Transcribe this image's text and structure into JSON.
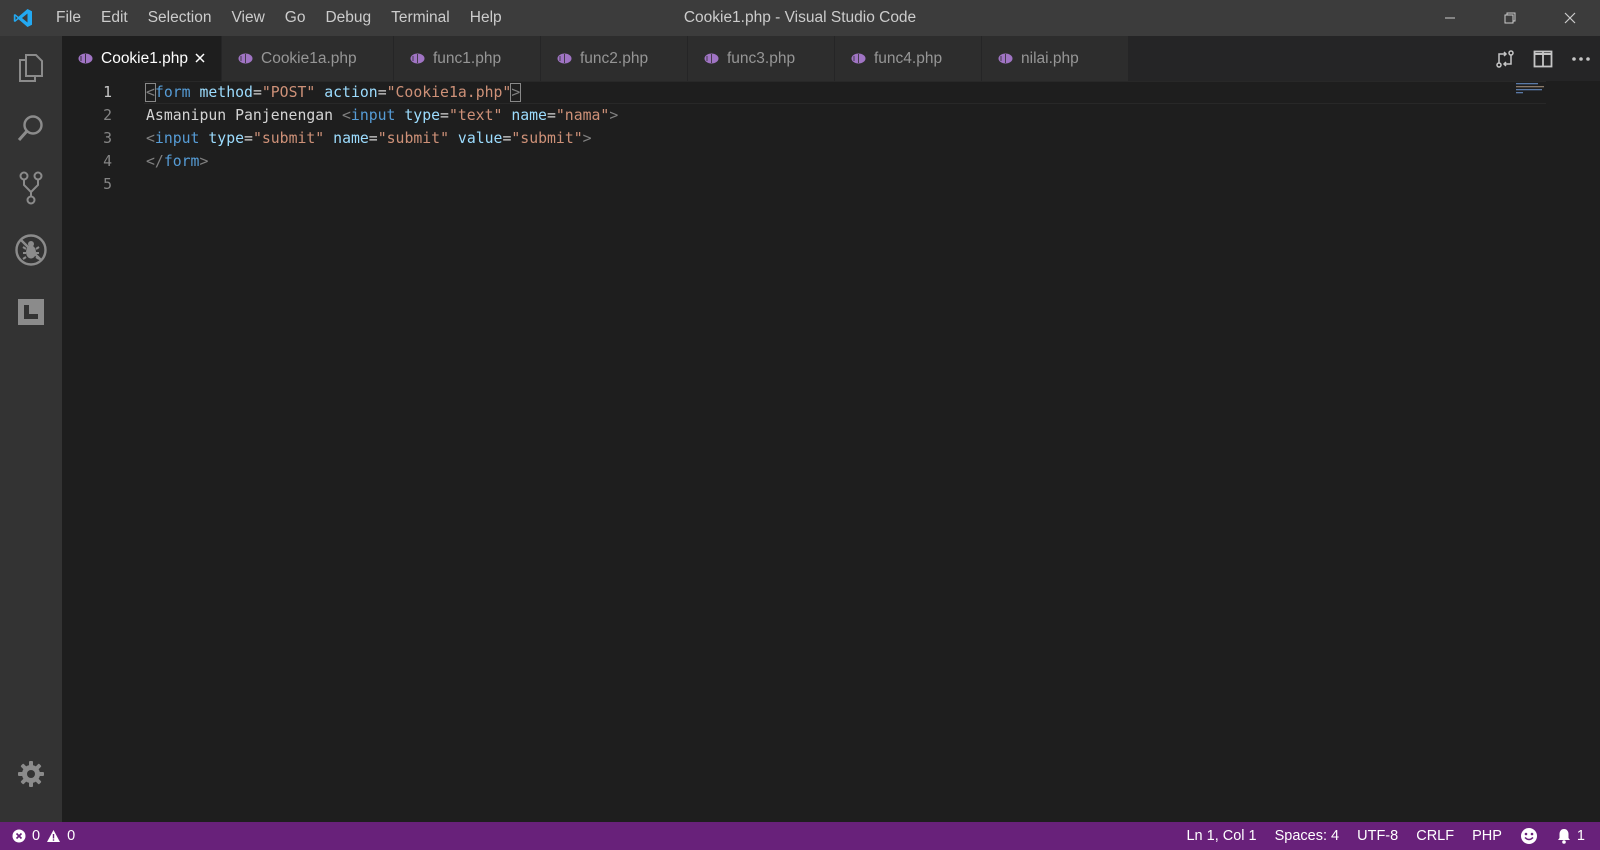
{
  "window": {
    "title": "Cookie1.php - Visual Studio Code",
    "app_icon": "vscode-logo"
  },
  "menu": {
    "items": [
      {
        "label": "File"
      },
      {
        "label": "Edit"
      },
      {
        "label": "Selection"
      },
      {
        "label": "View"
      },
      {
        "label": "Go"
      },
      {
        "label": "Debug"
      },
      {
        "label": "Terminal"
      },
      {
        "label": "Help"
      }
    ]
  },
  "activity_bar": {
    "icons": [
      "explorer-icon",
      "search-icon",
      "source-control-icon",
      "debug-icon",
      "extensions-icon",
      "settings-gear-icon"
    ]
  },
  "tabs": [
    {
      "label": "Cookie1.php",
      "active": true,
      "icon": "php-elephant-icon"
    },
    {
      "label": "Cookie1a.php",
      "active": false,
      "icon": "php-elephant-icon"
    },
    {
      "label": "func1.php",
      "active": false,
      "icon": "php-elephant-icon"
    },
    {
      "label": "func2.php",
      "active": false,
      "icon": "php-elephant-icon"
    },
    {
      "label": "func3.php",
      "active": false,
      "icon": "php-elephant-icon"
    },
    {
      "label": "func4.php",
      "active": false,
      "icon": "php-elephant-icon"
    },
    {
      "label": "nilai.php",
      "active": false,
      "icon": "php-elephant-icon"
    }
  ],
  "editor_actions": [
    "open-changes-icon",
    "split-editor-icon",
    "more-actions-icon"
  ],
  "editor": {
    "line_numbers": [
      "1",
      "2",
      "3",
      "4",
      "5"
    ],
    "current_line": 1,
    "lines": [
      "<form method=\"POST\" action=\"Cookie1a.php\">",
      "Asmanipun Panjenengan <input type=\"text\" name=\"nama\">",
      "<input type=\"submit\" name=\"submit\" value=\"submit\">",
      "</form>",
      ""
    ]
  },
  "status_bar": {
    "errors": "0",
    "warnings": "0",
    "position": "Ln 1, Col 1",
    "indent": "Spaces: 4",
    "encoding": "UTF-8",
    "eol": "CRLF",
    "language": "PHP",
    "notifications": "1"
  },
  "colors": {
    "statusbar": "#68217a",
    "titlebar": "#3c3c3c",
    "activitybar": "#333333",
    "editor_bg": "#1e1e1e",
    "tag": "#569cd6",
    "attribute": "#9cdcfe",
    "string": "#ce9178"
  }
}
